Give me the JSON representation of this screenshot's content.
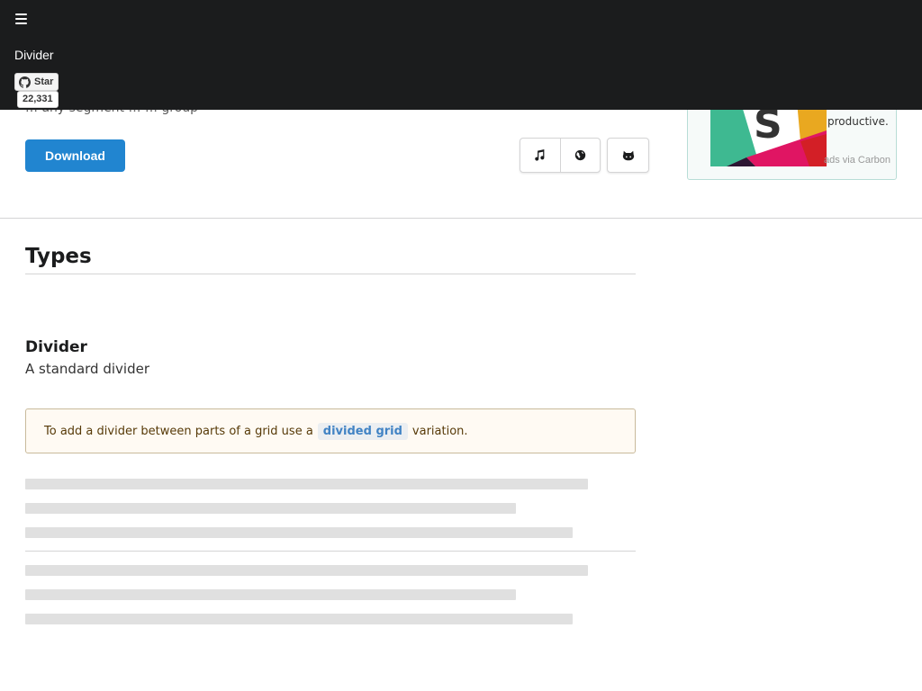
{
  "topbar": {
    "page_name": "Divider",
    "github": {
      "star_label": "Star",
      "star_count": "22,331"
    },
    "subtitle": "… any segment … … group"
  },
  "header": {
    "download_label": "Download",
    "icons": [
      "music-icon",
      "globe-icon",
      "github-icon"
    ]
  },
  "ad": {
    "text": "productive.",
    "via": "ads via Carbon",
    "logo_letter": "S",
    "colors": {
      "green": "#3eb991",
      "yellow": "#e9a820",
      "red": "#e01563",
      "dark": "#2d1633"
    }
  },
  "main": {
    "section_title": "Types",
    "example": {
      "title": "Divider",
      "description": "A standard divider",
      "note_before": "To add a divider between parts of a grid use a",
      "note_code": "divided grid",
      "note_after": "variation."
    }
  },
  "colors": {
    "primary": "#2185d0",
    "topbar": "#1b1c1d",
    "placeholder": "#e0e0e0"
  }
}
